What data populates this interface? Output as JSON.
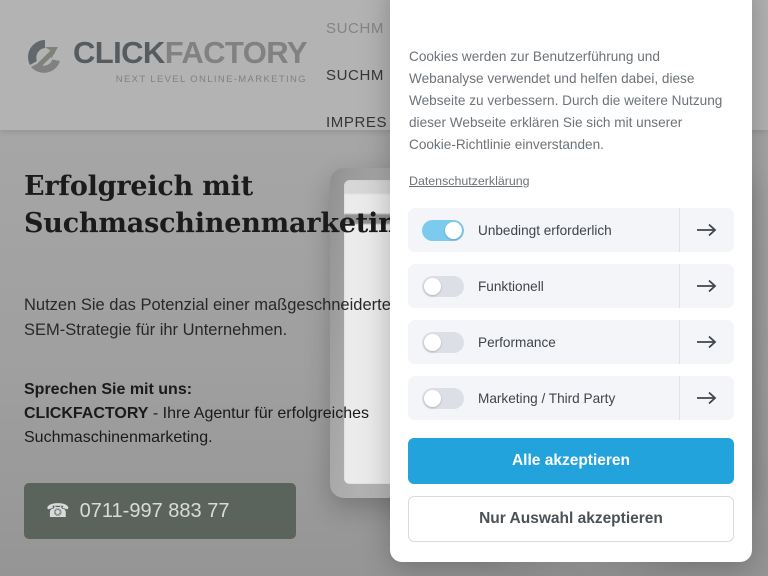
{
  "header": {
    "logo": {
      "part1": "CLICK",
      "part2": "FACTORY",
      "tagline": "NEXT LEVEL ONLINE-MARKETING"
    },
    "nav": [
      {
        "label": "SUCHM",
        "truncated": true
      },
      {
        "label": "SUCHM",
        "truncated": true
      },
      {
        "label": "IMPRES",
        "truncated": true
      }
    ]
  },
  "hero": {
    "title_line1": "Erfolgreich mit",
    "title_line2": "Suchmaschinenmarketing",
    "subtitle": "Nutzen Sie das Potenzial einer maßgeschneiderten SEM-Strategie für ihr Unternehmen.",
    "contact_heading": "Sprechen Sie mit uns:",
    "contact_brand": "CLICKFACTORY",
    "contact_rest": " - Ihre Agentur für erfolgreiches Suchmaschinenmarketing.",
    "phone_icon": "☎",
    "phone_number": "0711-997 883 77"
  },
  "cookie_modal": {
    "body_text": "Cookies werden zur Benutzerführung und Webanalyse verwendet und helfen dabei, diese Webseite zu verbessern. Durch die weitere Nutzung dieser Webseite erklären Sie sich mit unserer Cookie-Richtlinie einverstanden.",
    "privacy_link": "Datenschutzerklärung",
    "preferences": [
      {
        "label": "Unbedingt erforderlich",
        "enabled": true,
        "arrow": "→"
      },
      {
        "label": "Funktionell",
        "enabled": false,
        "arrow": "→"
      },
      {
        "label": "Performance",
        "enabled": false,
        "arrow": "→"
      },
      {
        "label": "Marketing / Third Party",
        "enabled": false,
        "arrow": "→"
      }
    ],
    "accept_all_label": "Alle akzeptieren",
    "accept_selection_label": "Nur Auswahl akzeptieren",
    "accent_color": "#22a3db",
    "toggle_on_color": "#7ccbee",
    "toggle_off_color": "#dcdfe6"
  }
}
